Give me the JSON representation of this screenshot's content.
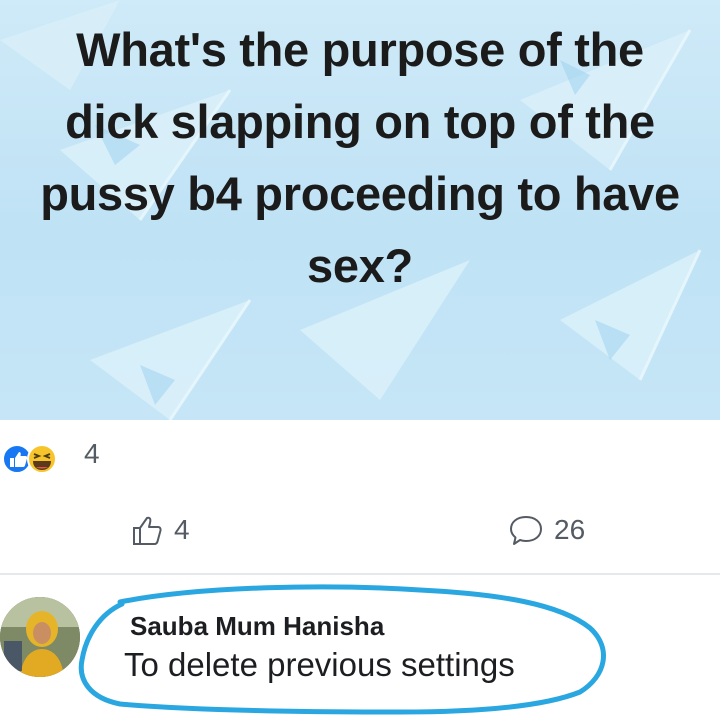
{
  "post": {
    "question_lines": [
      "What's the purpose of the",
      "dick slapping on top of the",
      "pussy b4 proceeding to have",
      "sex?"
    ]
  },
  "reactions": {
    "icons": [
      "like-icon",
      "haha-icon"
    ],
    "count": "4"
  },
  "actions": {
    "like_count": "4",
    "comment_count": "26"
  },
  "comment": {
    "author": "Sauba Mum Hanisha",
    "text": "To delete previous settings"
  },
  "colors": {
    "background": "#c4e4f6",
    "like_blue": "#1877f2",
    "haha_yellow": "#f7c52b",
    "highlight_circle": "#2aa7e0",
    "text_dark": "#1b1b1b",
    "text_muted": "#555b64"
  }
}
